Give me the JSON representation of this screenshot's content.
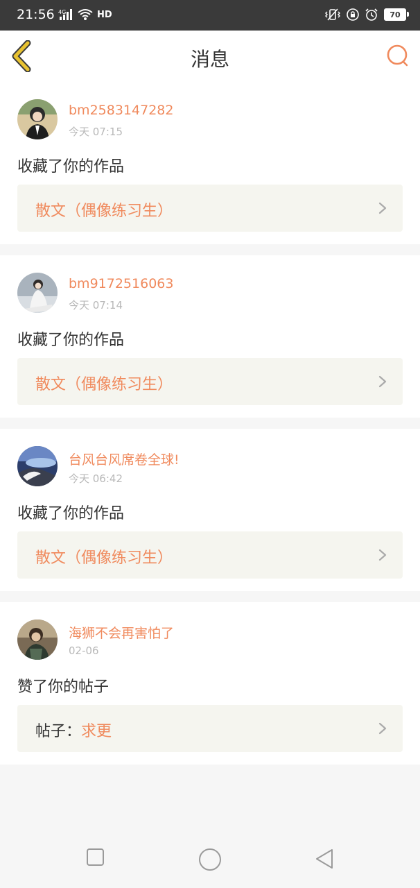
{
  "status_bar": {
    "time": "21:56",
    "network": "4G",
    "hd_label": "HD",
    "battery": "70"
  },
  "header": {
    "title": "消息",
    "back_icon": "chevron-left-icon",
    "search_icon": "search-icon",
    "accent": "#f08a5d",
    "back_color": "#e8c230"
  },
  "messages": [
    {
      "username": "bm2583147282",
      "time": "今天 07:15",
      "action": "收藏了你的作品",
      "ref_prefix": "",
      "ref_text": "散文（偶像练习生）"
    },
    {
      "username": "bm9172516063",
      "time": "今天 07:14",
      "action": "收藏了你的作品",
      "ref_prefix": "",
      "ref_text": "散文（偶像练习生）"
    },
    {
      "username": "台风台风席卷全球!",
      "time": "今天 06:42",
      "action": "收藏了你的作品",
      "ref_prefix": "",
      "ref_text": "散文（偶像练习生）"
    },
    {
      "username": "海狮不会再害怕了",
      "time": "02-06",
      "action": "赞了你的帖子",
      "ref_prefix": "帖子：",
      "ref_text": "求更"
    }
  ],
  "system_nav": {
    "recent_icon": "square-icon",
    "home_icon": "circle-icon",
    "back_icon": "triangle-back-icon"
  }
}
